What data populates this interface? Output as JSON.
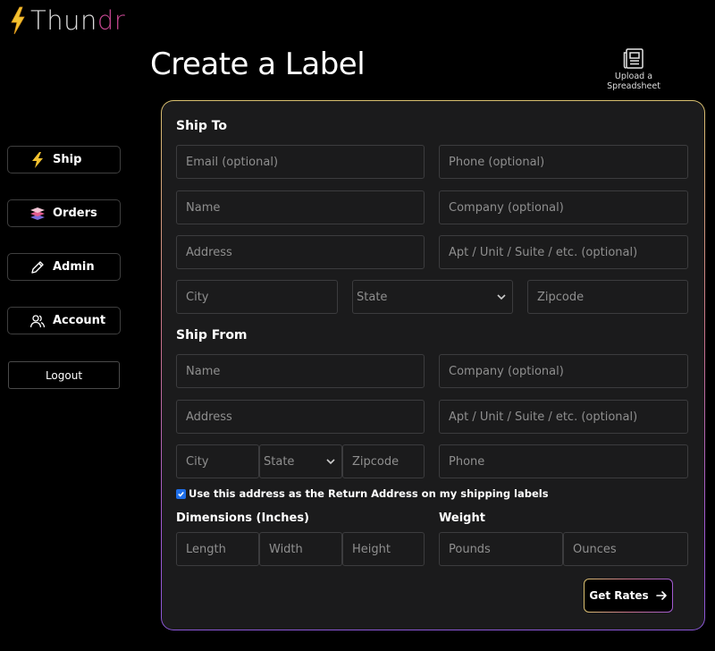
{
  "app": {
    "logo_primary": "Thun",
    "logo_secondary": "dr",
    "accent_colors": [
      "#d9c06f",
      "#c9728b",
      "#a15ad2"
    ]
  },
  "sidebar": {
    "items": [
      {
        "label": "Ship",
        "icon": "lightning-icon"
      },
      {
        "label": "Orders",
        "icon": "layers-icon"
      },
      {
        "label": "Admin",
        "icon": "pencil-icon"
      },
      {
        "label": "Account",
        "icon": "users-icon"
      }
    ],
    "logout_label": "Logout"
  },
  "page": {
    "title": "Create a Label",
    "upload_label_line1": "Upload a",
    "upload_label_line2": "Spreadsheet"
  },
  "ship_to": {
    "title": "Ship To",
    "email_placeholder": "Email (optional)",
    "phone_placeholder": "Phone (optional)",
    "name_placeholder": "Name",
    "company_placeholder": "Company (optional)",
    "address_placeholder": "Address",
    "apt_placeholder": "Apt / Unit / Suite / etc. (optional)",
    "city_placeholder": "City",
    "state_value": "State",
    "zip_placeholder": "Zipcode"
  },
  "ship_from": {
    "title": "Ship From",
    "name_placeholder": "Name",
    "company_placeholder": "Company (optional)",
    "address_placeholder": "Address",
    "apt_placeholder": "Apt / Unit / Suite / etc. (optional)",
    "city_placeholder": "City",
    "state_value": "State",
    "zip_placeholder": "Zipcode",
    "phone_placeholder": "Phone",
    "return_checkbox_label": "Use this address as the Return Address on my shipping labels",
    "return_checked": true
  },
  "dimensions": {
    "title": "Dimensions (Inches)",
    "length_placeholder": "Length",
    "width_placeholder": "Width",
    "height_placeholder": "Height"
  },
  "weight": {
    "title": "Weight",
    "pounds_placeholder": "Pounds",
    "ounces_placeholder": "Ounces"
  },
  "actions": {
    "get_rates_label": "Get Rates"
  }
}
